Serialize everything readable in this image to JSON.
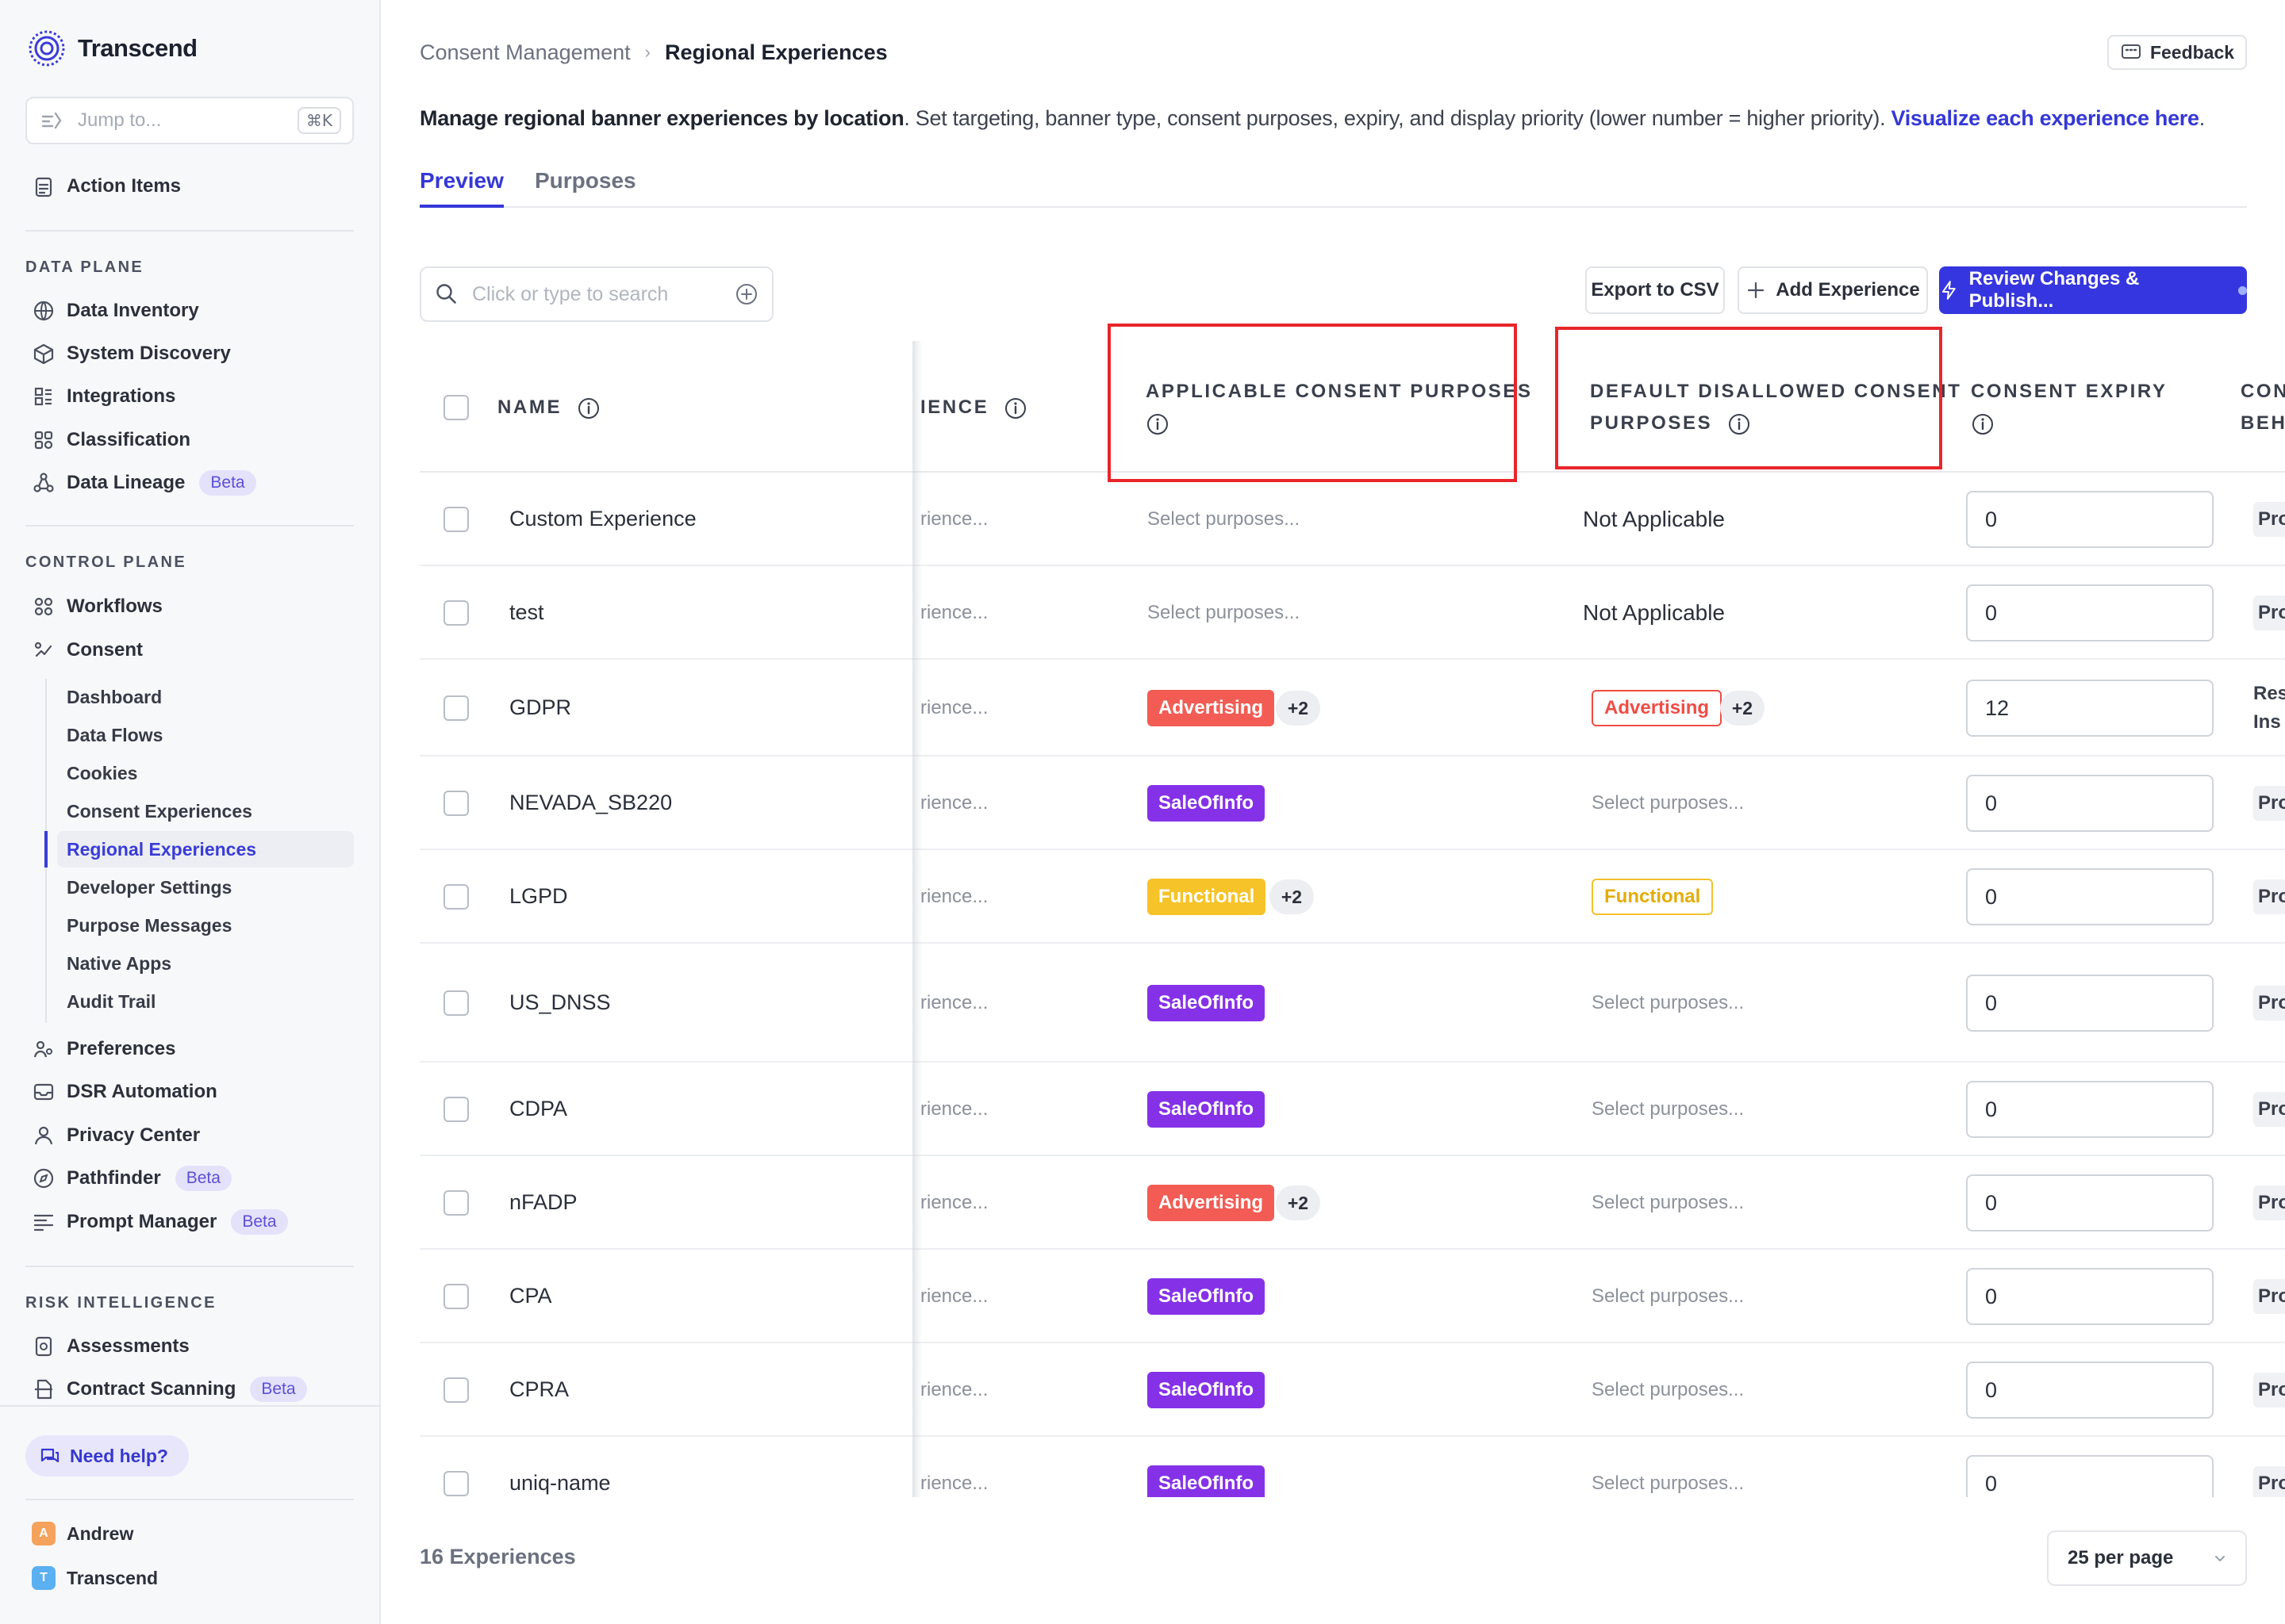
{
  "brand": {
    "name": "Transcend"
  },
  "jump": {
    "placeholder": "Jump to...",
    "shortcut": "⌘K"
  },
  "sidebar": {
    "action_items": "Action Items",
    "data_plane": {
      "title": "DATA PLANE",
      "items": [
        {
          "label": "Data Inventory",
          "icon": "globe-icon"
        },
        {
          "label": "System Discovery",
          "icon": "cube-icon"
        },
        {
          "label": "Integrations",
          "icon": "integrations-icon"
        },
        {
          "label": "Classification",
          "icon": "classification-icon"
        },
        {
          "label": "Data Lineage",
          "icon": "lineage-icon",
          "badge": "Beta"
        }
      ]
    },
    "control_plane": {
      "title": "CONTROL PLANE",
      "workflows": "Workflows",
      "consent": "Consent",
      "consent_sub": [
        "Dashboard",
        "Data Flows",
        "Cookies",
        "Consent Experiences",
        "Regional Experiences",
        "Developer Settings",
        "Purpose Messages",
        "Native Apps",
        "Audit Trail"
      ],
      "items": [
        {
          "label": "Preferences",
          "icon": "preferences-icon"
        },
        {
          "label": "DSR Automation",
          "icon": "inbox-icon"
        },
        {
          "label": "Privacy Center",
          "icon": "person-icon"
        },
        {
          "label": "Pathfinder",
          "icon": "compass-icon",
          "badge": "Beta"
        },
        {
          "label": "Prompt Manager",
          "icon": "prompt-icon",
          "badge": "Beta"
        }
      ]
    },
    "risk": {
      "title": "RISK INTELLIGENCE",
      "items": [
        {
          "label": "Assessments",
          "icon": "assessment-icon"
        },
        {
          "label": "Contract Scanning",
          "icon": "contract-icon",
          "badge": "Beta"
        }
      ]
    },
    "help": "Need help?",
    "users": [
      {
        "initial": "A",
        "name": "Andrew",
        "color": "#f5a35c"
      },
      {
        "initial": "T",
        "name": "Transcend",
        "color": "#5ab0f0"
      }
    ]
  },
  "header": {
    "breadcrumb": [
      "Consent Management",
      "Regional Experiences"
    ],
    "feedback": "Feedback",
    "description_bold": "Manage regional banner experiences by location",
    "description_rest": ". Set targeting, banner type, consent purposes, expiry, and display priority (lower number = higher priority). ",
    "description_link": "Visualize each experience here",
    "description_end": "."
  },
  "tabs": [
    "Preview",
    "Purposes"
  ],
  "toolbar": {
    "search_placeholder": "Click or type to search",
    "export": "Export to CSV",
    "add": "Add Experience",
    "publish": "Review Changes & Publish..."
  },
  "columns": {
    "name": "NAME",
    "experience": "IENCE",
    "applicable_1": "APPLICABLE CONSENT PURPOSES",
    "default_1": "DEFAULT DISALLOWED CONSENT",
    "default_2": "PURPOSES",
    "expiry": "CONSENT EXPIRY",
    "behavior_1": "CON",
    "behavior_2": "BEHA"
  },
  "rows": [
    {
      "name": "Custom Experience",
      "experience": "rience...",
      "applicable": {
        "placeholder": "Select purposes..."
      },
      "disallowed": {
        "text": "Not Applicable"
      },
      "expiry": "0",
      "behavior": "Pro"
    },
    {
      "name": "test",
      "experience": "rience...",
      "applicable": {
        "placeholder": "Select purposes..."
      },
      "disallowed": {
        "text": "Not Applicable"
      },
      "expiry": "0",
      "behavior": "Pro"
    },
    {
      "name": "GDPR",
      "experience": "rience...",
      "applicable": {
        "tag": "Advertising",
        "tag_type": "adv",
        "more": "+2"
      },
      "disallowed": {
        "tag": "Advertising",
        "tag_type": "adv-o",
        "more": "+2"
      },
      "expiry": "12",
      "behavior": "Res",
      "behavior_2": "Ins"
    },
    {
      "name": "NEVADA_SB220",
      "experience": "rience...",
      "applicable": {
        "tag": "SaleOfInfo",
        "tag_type": "sale"
      },
      "disallowed": {
        "placeholder": "Select purposes..."
      },
      "expiry": "0",
      "behavior": "Pro"
    },
    {
      "name": "LGPD",
      "experience": "rience...",
      "applicable": {
        "tag": "Functional",
        "tag_type": "func",
        "more": "+2"
      },
      "disallowed": {
        "tag": "Functional",
        "tag_type": "func-o"
      },
      "expiry": "0",
      "behavior": "Pro"
    },
    {
      "name": "US_DNSS",
      "experience": "rience...",
      "applicable": {
        "tag": "SaleOfInfo",
        "tag_type": "sale"
      },
      "disallowed": {
        "placeholder": "Select purposes..."
      },
      "expiry": "0",
      "behavior": "Pro"
    },
    {
      "name": "CDPA",
      "experience": "rience...",
      "applicable": {
        "tag": "SaleOfInfo",
        "tag_type": "sale"
      },
      "disallowed": {
        "placeholder": "Select purposes..."
      },
      "expiry": "0",
      "behavior": "Pro"
    },
    {
      "name": "nFADP",
      "experience": "rience...",
      "applicable": {
        "tag": "Advertising",
        "tag_type": "adv",
        "more": "+2"
      },
      "disallowed": {
        "placeholder": "Select purposes..."
      },
      "expiry": "0",
      "behavior": "Pro"
    },
    {
      "name": "CPA",
      "experience": "rience...",
      "applicable": {
        "tag": "SaleOfInfo",
        "tag_type": "sale"
      },
      "disallowed": {
        "placeholder": "Select purposes..."
      },
      "expiry": "0",
      "behavior": "Pro"
    },
    {
      "name": "CPRA",
      "experience": "rience...",
      "applicable": {
        "tag": "SaleOfInfo",
        "tag_type": "sale"
      },
      "disallowed": {
        "placeholder": "Select purposes..."
      },
      "expiry": "0",
      "behavior": "Pro"
    },
    {
      "name": "uniq-name",
      "experience": "rience...",
      "applicable": {
        "tag": "SaleOfInfo",
        "tag_type": "sale"
      },
      "disallowed": {
        "placeholder": "Select purposes..."
      },
      "expiry": "0",
      "behavior": "Pro"
    }
  ],
  "footer": {
    "count": "16 Experiences",
    "per_page": "25 per page"
  },
  "colors": {
    "accent": "#3538d6",
    "highlight": "#e8262a",
    "advertising": "#f25c54",
    "sale_of_info": "#8531e8",
    "functional": "#f6c328"
  }
}
